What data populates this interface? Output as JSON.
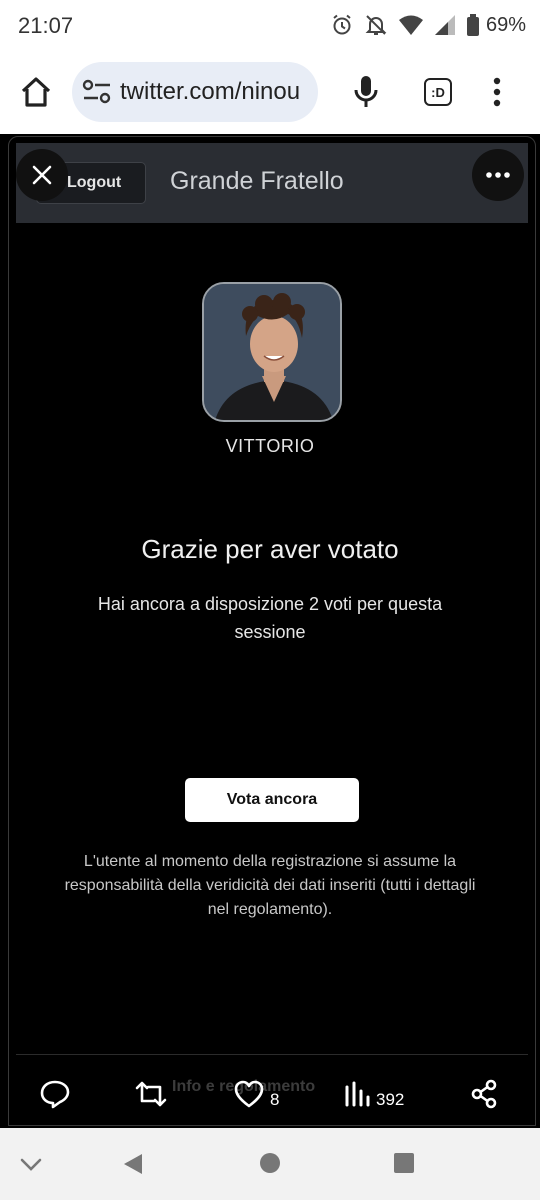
{
  "status_bar": {
    "time": "21:07",
    "battery": "69%"
  },
  "browser": {
    "url": "twitter.com/ninou",
    "extension_label": ":D"
  },
  "site": {
    "logout_label": "Logout",
    "title": "Grande Fratello"
  },
  "candidate": {
    "name": "VITTORIO"
  },
  "message": {
    "title": "Grazie per aver votato",
    "remaining_votes": "Hai ancora a disposizione 2 voti per questa sessione"
  },
  "vote_again_label": "Vota ancora",
  "disclaimer": "L'utente al momento della registrazione si assume la responsabilità della veridicità dei dati inseriti (tutti i dettagli nel regolamento).",
  "footer_link": "Info e regolamento",
  "tweet_actions": {
    "likes": "8",
    "views": "392"
  },
  "colors": {
    "background": "#000000",
    "header": "#2a2d33",
    "url_pill": "#e8edf6"
  }
}
